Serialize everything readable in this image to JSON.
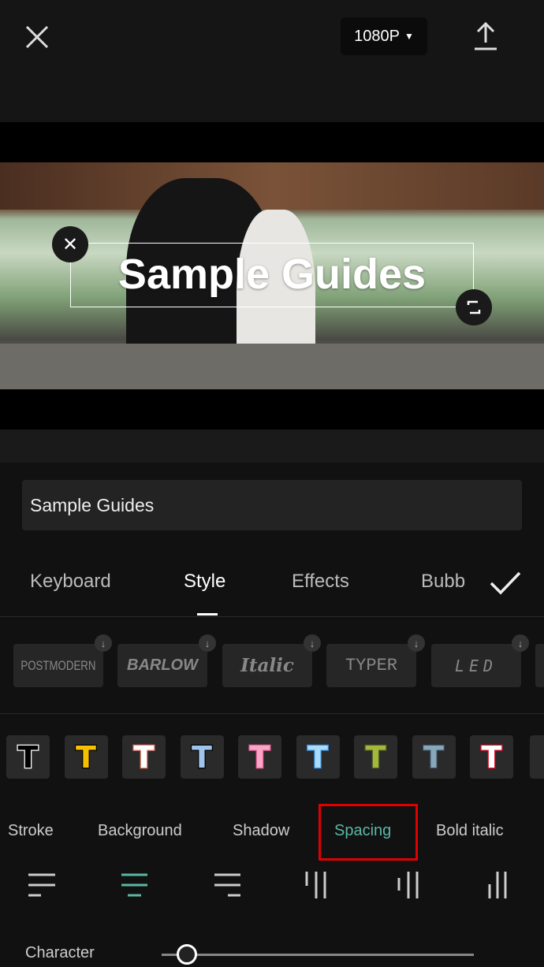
{
  "header": {
    "resolution": "1080P",
    "close_icon": "close-icon",
    "export_icon": "upload-icon"
  },
  "preview": {
    "overlay_text": "Sample Guides"
  },
  "text_input": {
    "value": "Sample Guides"
  },
  "tabs": [
    {
      "label": "Keyboard"
    },
    {
      "label": "Style",
      "active": true
    },
    {
      "label": "Effects"
    },
    {
      "label": "Bubb"
    }
  ],
  "fonts": [
    {
      "label": "POSTMODERN"
    },
    {
      "label": "BARLOW"
    },
    {
      "label": "Italic"
    },
    {
      "label": "TYPER"
    },
    {
      "label": "LED"
    }
  ],
  "swatches": [
    {
      "fill": "#000000",
      "stroke": "#ffffff"
    },
    {
      "fill": "#f5c000",
      "stroke": "#000000"
    },
    {
      "fill": "#ffffff",
      "stroke": "#e87a6a"
    },
    {
      "fill": "#9fc4ec",
      "stroke": "#000000"
    },
    {
      "fill": "#f7a6c4",
      "stroke": "#e8609a"
    },
    {
      "fill": "#a8dcf8",
      "stroke": "#3a86d8"
    },
    {
      "fill": "#a6b83a",
      "stroke": "#4a5a2a"
    },
    {
      "fill": "#86a8ba",
      "stroke": "#3a4a5a"
    },
    {
      "fill": "#ffffff",
      "stroke": "#e0102a"
    }
  ],
  "subtabs": [
    {
      "label": "Stroke"
    },
    {
      "label": "Background"
    },
    {
      "label": "Shadow"
    },
    {
      "label": "Spacing",
      "active": true
    },
    {
      "label": "Bold italic"
    }
  ],
  "alignment": {
    "options": [
      "align-left",
      "align-center",
      "align-right",
      "vertical-top",
      "vertical-center",
      "vertical-bottom"
    ],
    "selected": "align-center"
  },
  "character_spacing": {
    "label": "Character",
    "value_percent": 8
  },
  "colors": {
    "accent": "#5bb8a4",
    "highlight": "#e00000"
  }
}
